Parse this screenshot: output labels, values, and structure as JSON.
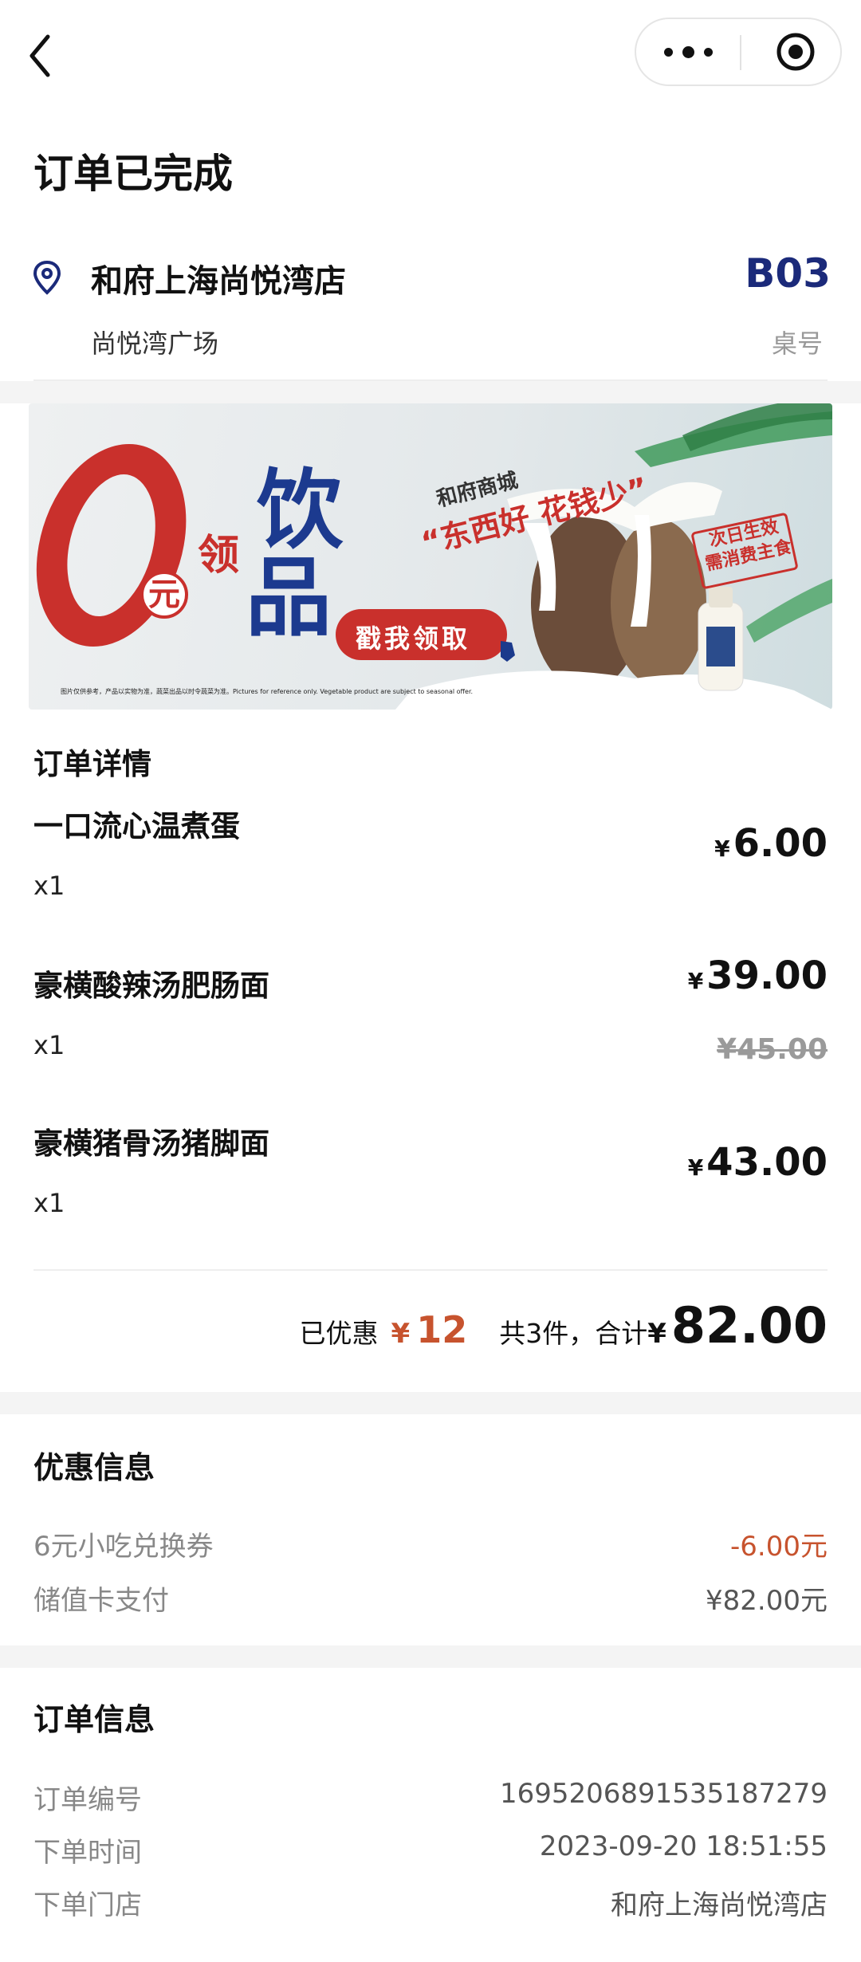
{
  "nav": {
    "back": "‹"
  },
  "page_title": "订单已完成",
  "store": {
    "name": "和府上海尚悦湾店",
    "sub": "尚悦湾广场",
    "table_no": "B03",
    "table_label": "桌号"
  },
  "banner": {
    "big_zero": "0",
    "yuan": "元",
    "ling": "领",
    "yin": "饮",
    "pin": "品",
    "brand": "和府商城",
    "slogan": "“东西好 花钱少”",
    "cta": "戳我领取",
    "stamp_line1": "次日生效",
    "stamp_line2": "需消费主食",
    "disclaimer": "图片仅供参考，产品以实物为准，蔬菜出品以时令蔬菜为准。Pictures for reference only. Vegetable product are subject to seasonal offer."
  },
  "order_detail": {
    "title": "订单详情",
    "currency": "¥",
    "items": [
      {
        "name": "一口流心温煮蛋",
        "qty": "x1",
        "price": "6.00"
      },
      {
        "name": "豪横酸辣汤肥肠面",
        "qty": "x1",
        "price": "39.00",
        "old_price": "¥45.00"
      },
      {
        "name": "豪横猪骨汤猪脚面",
        "qty": "x1",
        "price": "43.00"
      }
    ],
    "summary": {
      "discount_label": "已优惠",
      "discount": "12",
      "count_label": "共3件，合计",
      "total": "82.00"
    }
  },
  "promo": {
    "title": "优惠信息",
    "rows": [
      {
        "label": "6元小吃兑换券",
        "value": "-6.00元"
      },
      {
        "label": "储值卡支付",
        "value": "¥82.00元"
      }
    ]
  },
  "order_info": {
    "title": "订单信息",
    "rows": [
      {
        "label": "订单编号",
        "value": "1695206891535187279"
      },
      {
        "label": "下单时间",
        "value": "2023-09-20 18:51:55"
      },
      {
        "label": "下单门店",
        "value": "和府上海尚悦湾店"
      }
    ]
  },
  "colors": {
    "accent_red": "#c7532e",
    "table_blue": "#1b2a7a",
    "banner_red": "#c9302c"
  }
}
